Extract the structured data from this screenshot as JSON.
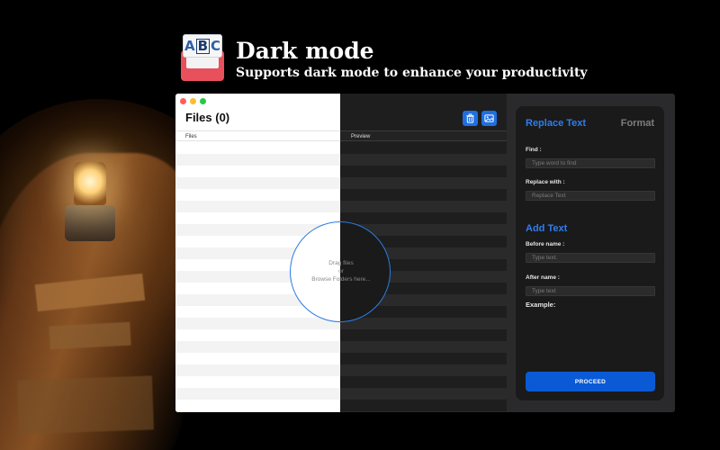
{
  "header": {
    "app_logo_text": {
      "a": "A",
      "b": "B",
      "c": "C"
    },
    "headline": "Dark mode",
    "subheadline": "Supports dark mode to enhance your productivity"
  },
  "window": {
    "files_title": "Files (0)",
    "columns": {
      "files": "Files",
      "preview": "Preview"
    },
    "drop_zone": {
      "line1": "Drag files",
      "line2": "or",
      "line3": "Browse Folders here..."
    },
    "toolbar": {
      "trash_icon": "trash-icon",
      "image_icon": "image-icon"
    }
  },
  "panel": {
    "tabs": {
      "replace": "Replace Text",
      "format": "Format"
    },
    "find_label": "Find :",
    "find_placeholder": "Type word to find",
    "replace_label": "Replace with :",
    "replace_placeholder": "Replace Text",
    "add_text_title": "Add Text",
    "before_label": "Before name :",
    "before_placeholder": "Type text.",
    "after_label": "After name :",
    "after_placeholder": "Type text",
    "example_label": "Example:",
    "proceed_label": "PROCEED"
  },
  "colors": {
    "accent": "#2f7df0",
    "button": "#0a5ad6",
    "logo_red": "#e8505b"
  }
}
